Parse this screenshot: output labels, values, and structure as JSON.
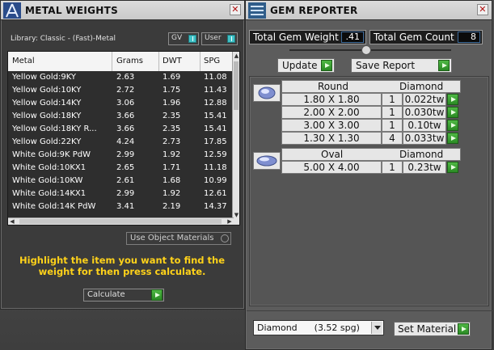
{
  "metal_weights": {
    "title": "METAL WEIGHTS",
    "library_label": "Library: Classic - (Fast)-Metal",
    "toggle_gv": "GV",
    "toggle_user": "User",
    "columns": [
      "Metal",
      "Grams",
      "DWT",
      "SPG"
    ],
    "rows": [
      [
        "Yellow Gold:9KY",
        "2.63",
        "1.69",
        "11.08"
      ],
      [
        "Yellow Gold:10KY",
        "2.72",
        "1.75",
        "11.43"
      ],
      [
        "Yellow Gold:14KY",
        "3.06",
        "1.96",
        "12.88"
      ],
      [
        "Yellow Gold:18KY",
        "3.66",
        "2.35",
        "15.41"
      ],
      [
        "Yellow Gold:18KY R...",
        "3.66",
        "2.35",
        "15.41"
      ],
      [
        "Yellow Gold:22KY",
        "4.24",
        "2.73",
        "17.85"
      ],
      [
        "White Gold:9K PdW",
        "2.99",
        "1.92",
        "12.59"
      ],
      [
        "White Gold:10KX1",
        "2.65",
        "1.71",
        "11.18"
      ],
      [
        "White Gold:10KW",
        "2.61",
        "1.68",
        "10.99"
      ],
      [
        "White Gold:14KX1",
        "2.99",
        "1.92",
        "12.61"
      ],
      [
        "White Gold:14K PdW",
        "3.41",
        "2.19",
        "14.37"
      ]
    ],
    "use_object_materials": "Use Object Materials",
    "instructions": "Highlight the item you want to find the weight for then press calculate.",
    "calculate_label": "Calculate"
  },
  "gem_reporter": {
    "title": "GEM REPORTER",
    "total_weight_label": "Total Gem Weight",
    "total_weight_value": ".41",
    "total_count_label": "Total Gem Count",
    "total_count_value": "8",
    "update_label": "Update",
    "save_report_label": "Save Report",
    "groups": [
      {
        "shape": "Round",
        "material": "Diamond",
        "items": [
          {
            "size": "1.80 X 1.80",
            "count": "1",
            "weight": "0.022tw"
          },
          {
            "size": "2.00 X 2.00",
            "count": "1",
            "weight": "0.030tw"
          },
          {
            "size": "3.00 X 3.00",
            "count": "1",
            "weight": "0.10tw"
          },
          {
            "size": "1.30 X 1.30",
            "count": "4",
            "weight": "0.033tw"
          }
        ]
      },
      {
        "shape": "Oval",
        "material": "Diamond",
        "items": [
          {
            "size": "5.00 X 4.00",
            "count": "1",
            "weight": "0.23tw"
          }
        ]
      }
    ],
    "material_select_value": "Diamond      (3.52 spg)",
    "set_material_label": "Set Material"
  }
}
